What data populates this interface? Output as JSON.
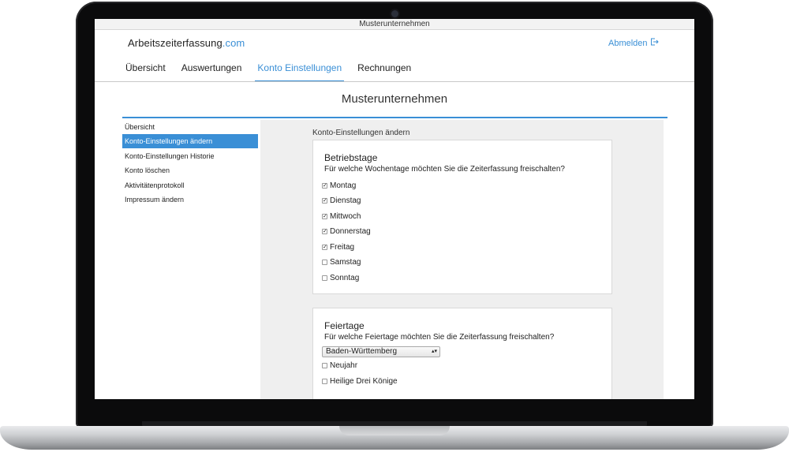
{
  "window": {
    "title": "Musterunternehmen"
  },
  "brand": {
    "name": "Arbeitszeiterfassung",
    "tld": ".com"
  },
  "header": {
    "logout_label": "Abmelden",
    "logout_icon": "logout-icon"
  },
  "nav": {
    "items": [
      {
        "label": "Übersicht"
      },
      {
        "label": "Auswertungen"
      },
      {
        "label": "Konto Einstellungen"
      },
      {
        "label": "Rechnungen"
      }
    ],
    "active_index": 2
  },
  "company_title": "Musterunternehmen",
  "sidebar": {
    "items": [
      {
        "label": "Übersicht"
      },
      {
        "label": "Konto-Einstellungen ändern"
      },
      {
        "label": "Konto-Einstellungen Historie"
      },
      {
        "label": "Konto löschen"
      },
      {
        "label": "Aktivitätenprotokoll"
      },
      {
        "label": "Impressum ändern"
      }
    ],
    "active_index": 1
  },
  "content": {
    "title": "Konto-Einstellungen ändern",
    "betriebstage": {
      "heading": "Betriebstage",
      "question": "Für welche Wochentage möchten Sie die Zeiterfassung freischalten?",
      "days": [
        {
          "label": "Montag",
          "checked": true
        },
        {
          "label": "Dienstag",
          "checked": true
        },
        {
          "label": "Mittwoch",
          "checked": true
        },
        {
          "label": "Donnerstag",
          "checked": true
        },
        {
          "label": "Freitag",
          "checked": true
        },
        {
          "label": "Samstag",
          "checked": false
        },
        {
          "label": "Sonntag",
          "checked": false
        }
      ]
    },
    "feiertage": {
      "heading": "Feiertage",
      "question": "Für welche Feiertage möchten Sie die Zeiterfassung freischalten?",
      "region_selected": "Baden-Württemberg",
      "holidays": [
        {
          "label": "Neujahr",
          "checked": false
        },
        {
          "label": "Heilige Drei Könige",
          "checked": false
        }
      ]
    }
  },
  "colors": {
    "accent": "#3a8fd6",
    "content_bg": "#efefef"
  }
}
